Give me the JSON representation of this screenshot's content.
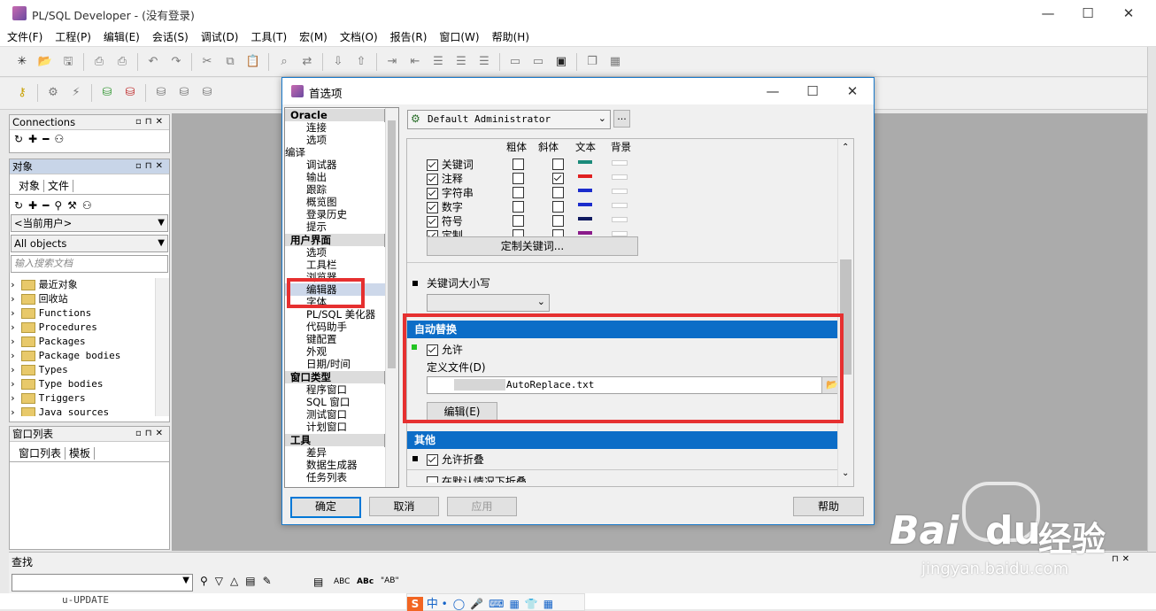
{
  "app": {
    "title": "PL/SQL Developer - (没有登录)"
  },
  "menu": [
    "文件(F)",
    "工程(P)",
    "编辑(E)",
    "会话(S)",
    "调试(D)",
    "工具(T)",
    "宏(M)",
    "文档(O)",
    "报告(R)",
    "窗口(W)",
    "帮助(H)"
  ],
  "panels": {
    "connections": {
      "title": "Connections"
    },
    "objects": {
      "title": "对象",
      "tabs": [
        "对象",
        "文件"
      ],
      "user_filter": "<当前用户>",
      "type_filter": "All objects",
      "search_placeholder": "输入搜索文档",
      "tree": [
        "最近对象",
        "回收站",
        "Functions",
        "Procedures",
        "Packages",
        "Package bodies",
        "Types",
        "Type bodies",
        "Triggers",
        "Java sources"
      ]
    },
    "windowlist": {
      "title": "窗口列表",
      "tabs": [
        "窗口列表",
        "模板"
      ]
    }
  },
  "find": {
    "title": "查找",
    "abc": "ABC",
    "ab_quoted": "\"AB\""
  },
  "bottom": {
    "text": "u-UPDATE",
    "ime": "中"
  },
  "watermark": {
    "brand": "Bai",
    "du": "du",
    "cn": "经验",
    "url": "jingyan.baidu.com"
  },
  "dialog": {
    "title": "首选项",
    "profile": "Default Administrator",
    "more": "...",
    "nav": [
      {
        "group": "Oracle",
        "items": [
          "连接",
          "选项"
        ]
      },
      {
        "top": "编译",
        "items": [
          "调试器",
          "输出",
          "跟踪",
          "概览图",
          "登录历史",
          "提示"
        ]
      },
      {
        "group": "用户界面",
        "items": [
          "选项",
          "工具栏",
          "浏览器",
          "编辑器",
          "字体",
          "PL/SQL 美化器",
          "代码助手",
          "键配置",
          "外观",
          "日期/时间"
        ]
      },
      {
        "group": "窗口类型",
        "items": [
          "程序窗口",
          "SQL 窗口",
          "测试窗口",
          "计划窗口"
        ]
      },
      {
        "group": "工具",
        "items": [
          "差异",
          "数据生成器",
          "任务列表"
        ]
      }
    ],
    "style_headers": [
      "粗体",
      "斜体",
      "文本",
      "背景"
    ],
    "style_rows": [
      {
        "label": "关键词",
        "bold": false,
        "italic": false,
        "color": "#1a8a7a"
      },
      {
        "label": "注释",
        "bold": false,
        "italic": true,
        "color": "#e02020"
      },
      {
        "label": "字符串",
        "bold": false,
        "italic": false,
        "color": "#1b2ccc"
      },
      {
        "label": "数字",
        "bold": false,
        "italic": false,
        "color": "#1b2ccc"
      },
      {
        "label": "符号",
        "bold": false,
        "italic": false,
        "color": "#101a60"
      },
      {
        "label": "定制",
        "bold": false,
        "italic": false,
        "color": "#8a1a8a"
      }
    ],
    "custom_keywords_button": "定制关键词...",
    "keyword_case_label": "关键词大小写",
    "autoreplace": {
      "title": "自动替换",
      "allow": "允许",
      "file_label": "定义文件(D)",
      "file_value": "AutoReplace.txt",
      "edit_button": "编辑(E)"
    },
    "other": {
      "title": "其他",
      "allow_fold": "允许折叠",
      "cut_line": "在默认情况下折叠"
    },
    "buttons": {
      "ok": "确定",
      "cancel": "取消",
      "apply": "应用",
      "help": "帮助"
    }
  }
}
